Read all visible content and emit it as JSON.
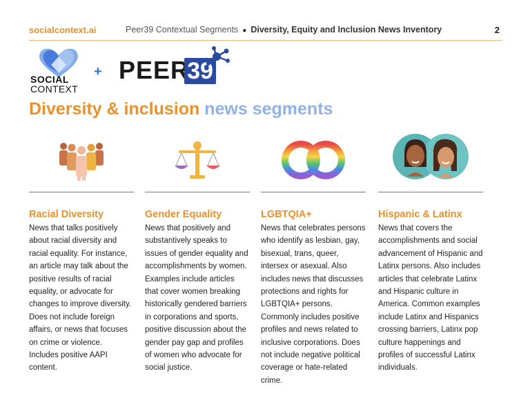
{
  "header": {
    "brand": "socialcontext.ai",
    "crumb_a": "Peer39 Contextual Segments",
    "crumb_b": "Diversity, Equity and Inclusion News Inventory",
    "page_number": "2"
  },
  "logos": {
    "social_line1": "SOCIAL",
    "social_line2": "CONTEXT",
    "plus": "+",
    "peer_text": "PEER",
    "peer_box": "39"
  },
  "title": {
    "part1": "Diversity & inclusion",
    "part2": "news segments"
  },
  "segments": [
    {
      "icon": "people-group-icon",
      "heading": "Racial Diversity",
      "body": "News that talks positively about racial diversity and racial equality. For instance, an article may talk about the positive results of racial equality, or advocate for changes to improve diversity. Does not include foreign affairs, or news that focuses on crime or violence. Includes positive AAPI content."
    },
    {
      "icon": "balance-scale-icon",
      "heading": "Gender Equality",
      "body": "News that positively and substantively speaks to issues of gender equality and accomplishments by women. Examples include articles that cover women breaking historically gendered barriers in corporations and sports, positive discussion about the gender pay gap and profiles of women who advocate for social justice."
    },
    {
      "icon": "rainbow-rings-icon",
      "heading": "LGBTQIA+",
      "body": "News that celebrates persons who identify as lesbian, gay, bisexual, trans, queer, intersex or asexual. Also includes news that discusses protections and rights for LGBTQIA+ persons. Commonly includes positive profiles and news related to inclusive corporations. Does not include negative political coverage or hate-related crime."
    },
    {
      "icon": "two-faces-icon",
      "heading": "Hispanic & Latinx",
      "body": "News that covers the accomplishments and social advancement of Hispanic and Latinx persons. Also includes articles that celebrate Latinx and Hispanic culture in America. Common examples include Latinx and Hispanics crossing barriers, Latinx pop culture happenings and profiles of successful Latinx individuals."
    }
  ],
  "colors": {
    "accent": "#e8912d",
    "accent_light": "#8fb3e6",
    "peer_blue": "#2a4aa0"
  }
}
